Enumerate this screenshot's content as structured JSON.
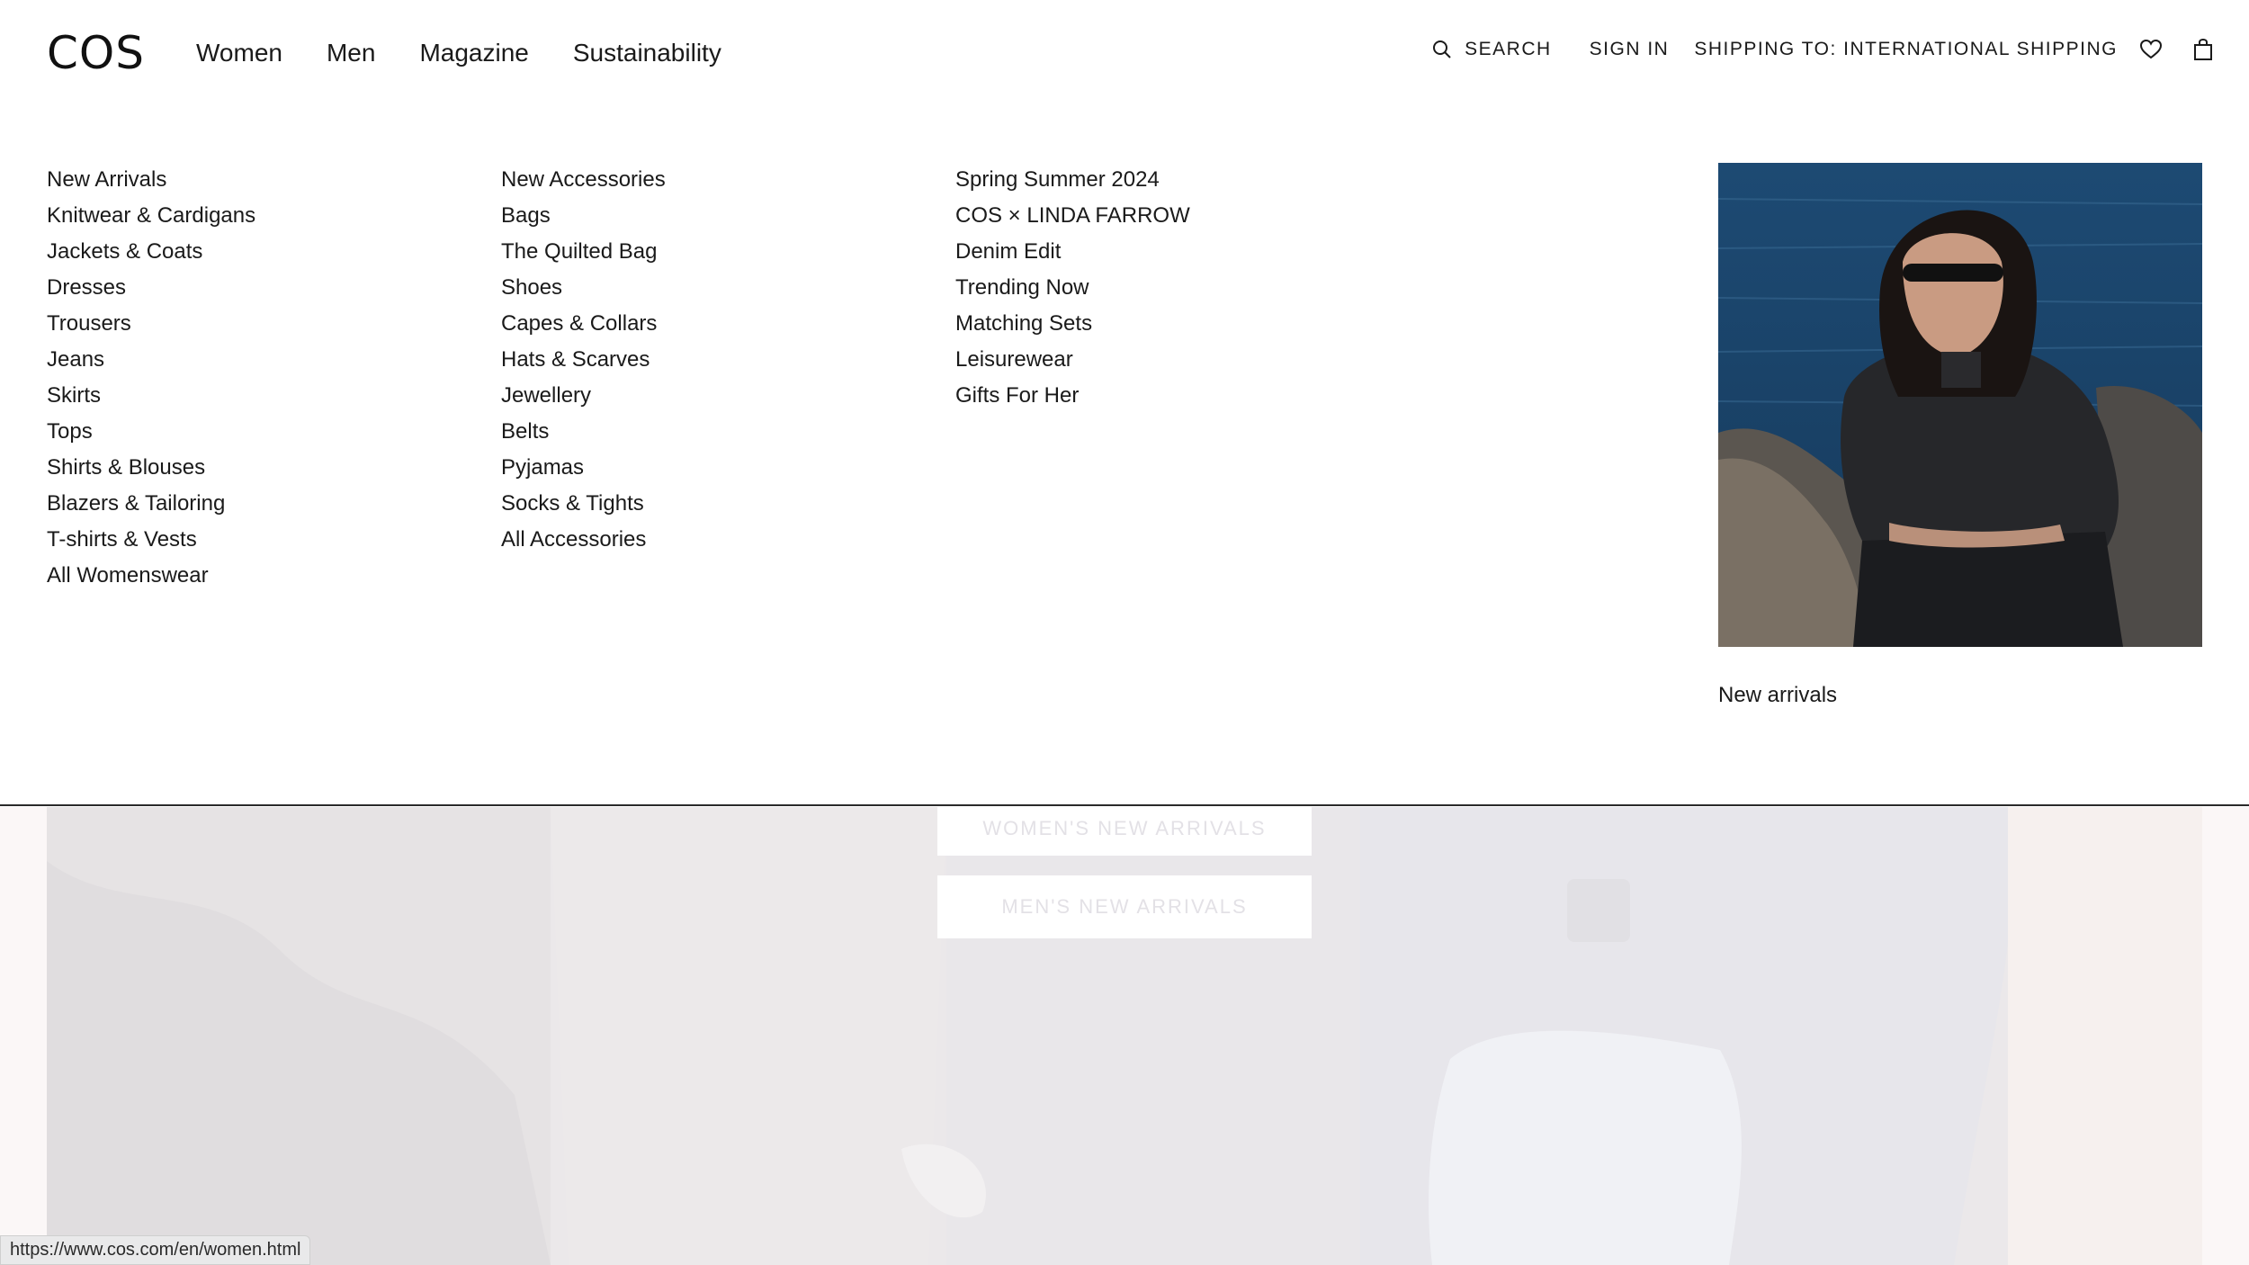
{
  "brand": {
    "logo": "COS"
  },
  "nav": {
    "items": [
      {
        "label": "Women"
      },
      {
        "label": "Men"
      },
      {
        "label": "Magazine"
      },
      {
        "label": "Sustainability"
      }
    ]
  },
  "utilities": {
    "search_label": "SEARCH",
    "sign_in_label": "SIGN IN",
    "shipping_label": "SHIPPING TO: INTERNATIONAL SHIPPING",
    "wishlist_icon": "heart-icon",
    "bag_icon": "shopping-bag-icon"
  },
  "mega_menu": {
    "clothing": [
      "New Arrivals",
      "Knitwear & Cardigans",
      "Jackets & Coats",
      "Dresses",
      "Trousers",
      "Jeans",
      "Skirts",
      "Tops",
      "Shirts & Blouses",
      "Blazers & Tailoring",
      "T-shirts & Vests",
      "All Womenswear"
    ],
    "accessories": [
      "New Accessories",
      "Bags",
      "The Quilted Bag",
      "Shoes",
      "Capes & Collars",
      "Hats & Scarves",
      "Jewellery",
      "Belts",
      "Pyjamas",
      "Socks & Tights",
      "All Accessories"
    ],
    "collections": [
      "Spring Summer 2024",
      "COS × LINDA FARROW",
      "Denim Edit",
      "Trending Now",
      "Matching Sets",
      "Leisurewear",
      "Gifts For Her"
    ],
    "promo": {
      "caption": "New arrivals"
    }
  },
  "background_page": {
    "women_button": "WOMEN'S NEW ARRIVALS",
    "men_button": "MEN'S NEW ARRIVALS"
  },
  "status_bar": {
    "url": "https://www.cos.com/en/women.html"
  }
}
